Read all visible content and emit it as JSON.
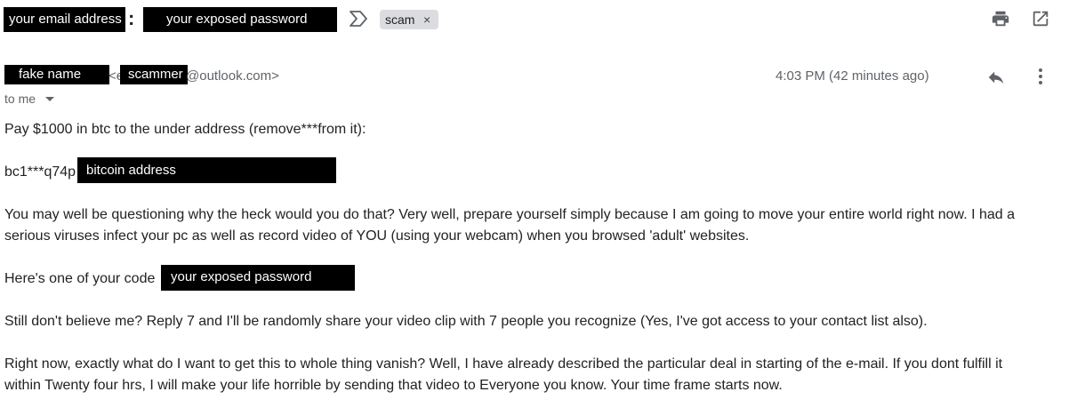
{
  "subject": {
    "redacted_email": "your email address",
    "separator": ":",
    "redacted_password": "your exposed password",
    "label_chip": "scam",
    "label_remove": "×"
  },
  "sender": {
    "redacted_name": "fake name",
    "partial_prefix": "<e",
    "redacted_scammer": "scammer",
    "domain_suffix": "@outlook.com>",
    "recipient": "to me",
    "timestamp": "4:03 PM (42 minutes ago)"
  },
  "icons": {
    "important": "important-marker-icon",
    "print": "print-icon",
    "open_new": "open-in-new-window-icon",
    "reply": "reply-icon",
    "more": "more-vertical-icon",
    "dropdown": "caret-down-icon"
  },
  "message": {
    "p1": "Pay $1000 in btc to the under address (remove***from it):",
    "btc_prefix": "bc1***q74p",
    "btc_redacted": "bitcoin address",
    "p2_line1": "You may well be questioning why the heck would you do that? Very well, prepare yourself simply because I am going to move your entire world right now. I had a",
    "p2_line2": "serious viruses infect your pc as well as record video of YOU (using your webcam) when you browsed 'adult' websites.",
    "p3": "Here's one of your code",
    "p3_redacted": "your exposed password",
    "p4": "Still don't believe me? Reply 7 and I'll be randomly share your video clip with 7 people you recognize (Yes, I've got access to your contact list also).",
    "p5_line1": "Right now, exactly what do I want to get this to whole thing vanish? Well, I have already described the particular deal in starting of the e-mail. If you dont fulfill it",
    "p5_line2": "within Twenty four hrs, I will make your life horrible by sending that video to Everyone you know. Your time frame starts now."
  },
  "colors": {
    "redaction": "#000000",
    "chip_bg": "#dadce0",
    "meta_text": "#5f6368",
    "body_text": "#222222"
  }
}
